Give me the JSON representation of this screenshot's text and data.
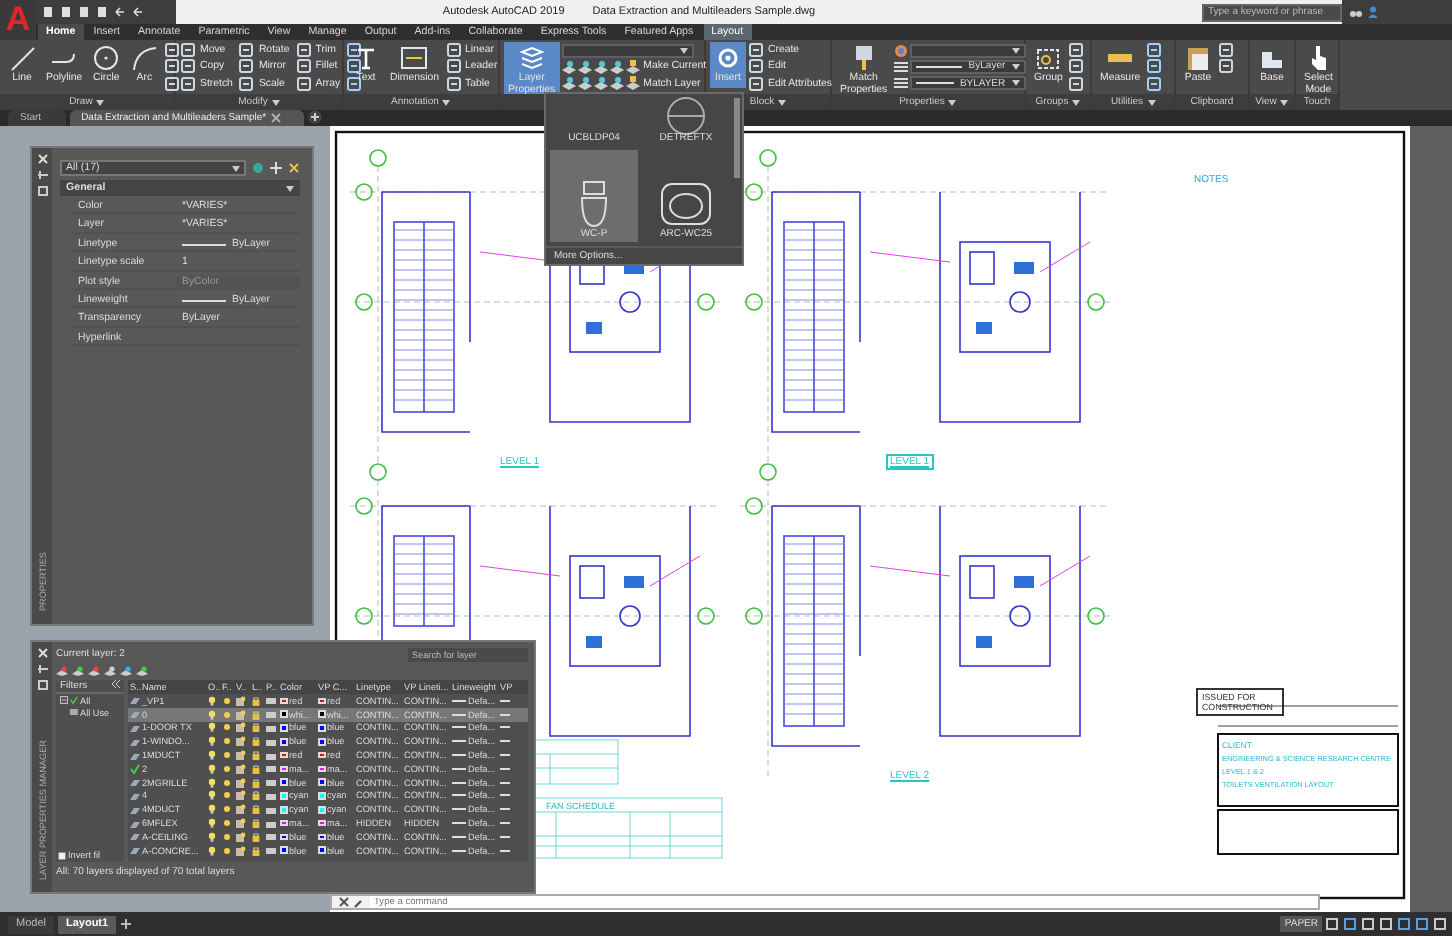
{
  "title_bar": {
    "app_letter": "A",
    "title": "Autodesk AutoCAD 2019",
    "document": "Data Extraction and Multileaders Sample.dwg",
    "search": {
      "placeholder": "Type a keyword or phrase"
    }
  },
  "ribbon_tabs": [
    {
      "label": "Home",
      "selected": true,
      "contextual": false
    },
    {
      "label": "Insert",
      "selected": false,
      "contextual": false
    },
    {
      "label": "Annotate",
      "selected": false,
      "contextual": false
    },
    {
      "label": "Parametric",
      "selected": false,
      "contextual": false
    },
    {
      "label": "View",
      "selected": false,
      "contextual": false
    },
    {
      "label": "Manage",
      "selected": false,
      "contextual": false
    },
    {
      "label": "Output",
      "selected": false,
      "contextual": false
    },
    {
      "label": "Add-ins",
      "selected": false,
      "contextual": false
    },
    {
      "label": "Collaborate",
      "selected": false,
      "contextual": false
    },
    {
      "label": "Express Tools",
      "selected": false,
      "contextual": false
    },
    {
      "label": "Featured Apps",
      "selected": false,
      "contextual": false
    },
    {
      "label": "Layout",
      "selected": false,
      "contextual": true
    }
  ],
  "ribbon_panels": [
    {
      "label": "Draw",
      "menu": true,
      "tools": [
        {
          "kind": "large",
          "label": "Line",
          "active": false
        },
        {
          "kind": "large",
          "label": "Polyline",
          "active": false
        },
        {
          "kind": "large",
          "label": "Circle",
          "active": false
        },
        {
          "kind": "large",
          "label": "Arc",
          "active": false
        },
        {
          "kind": "icon"
        },
        {
          "kind": "icon"
        },
        {
          "kind": "icon"
        }
      ]
    },
    {
      "label": "Modify",
      "menu": true,
      "tools": [
        {
          "kind": "small",
          "label": "Move"
        },
        {
          "kind": "small",
          "label": "Copy"
        },
        {
          "kind": "small",
          "label": "Stretch"
        },
        {
          "kind": "small",
          "label": "Rotate"
        },
        {
          "kind": "small",
          "label": "Mirror"
        },
        {
          "kind": "small",
          "label": "Scale"
        },
        {
          "kind": "small",
          "label": "Trim"
        },
        {
          "kind": "small",
          "label": "Fillet"
        },
        {
          "kind": "small",
          "label": "Array"
        },
        {
          "kind": "icon"
        },
        {
          "kind": "icon"
        },
        {
          "kind": "icon"
        }
      ]
    },
    {
      "label": "Annotation",
      "menu": true,
      "tools": [
        {
          "kind": "large",
          "label": "Text",
          "active": false
        },
        {
          "kind": "large",
          "label": "Dimension",
          "active": false
        },
        {
          "kind": "small",
          "label": "Linear"
        },
        {
          "kind": "small",
          "label": "Leader"
        },
        {
          "kind": "small",
          "label": "Table"
        }
      ]
    },
    {
      "tools": [
        {
          "kind": "large",
          "label": "Layer Properties",
          "active": true
        },
        {
          "kind": "dropdown"
        },
        {
          "kind": "layer-row",
          "label": "Make Current"
        },
        {
          "kind": "layer-row",
          "label": "Match Layer"
        }
      ]
    },
    {
      "label": "Block",
      "menu": true,
      "tools": [
        {
          "kind": "large",
          "label": "Insert",
          "active": true
        },
        {
          "kind": "small",
          "label": "Create"
        },
        {
          "kind": "small",
          "label": "Edit"
        },
        {
          "kind": "small",
          "label": "Edit Attributes"
        }
      ]
    },
    {
      "label": "Properties",
      "menu": true,
      "tools": [
        {
          "kind": "large",
          "label": "Match Properties",
          "active": false
        },
        {
          "kind": "color-dropdown"
        },
        {
          "kind": "line-dropdown",
          "label": "ByLayer"
        },
        {
          "kind": "line-dropdown",
          "label": "BYLAYER"
        }
      ]
    },
    {
      "label": "Groups",
      "menu": true,
      "tools": [
        {
          "kind": "large",
          "label": "Group",
          "active": false
        },
        {
          "kind": "icon"
        },
        {
          "kind": "icon"
        },
        {
          "kind": "icon"
        }
      ]
    },
    {
      "label": "Utilities",
      "menu": true,
      "tools": [
        {
          "kind": "large",
          "label": "Measure",
          "active": false
        },
        {
          "kind": "icon"
        },
        {
          "kind": "icon"
        },
        {
          "kind": "icon"
        }
      ]
    },
    {
      "label": "Clipboard",
      "menu": false,
      "tools": [
        {
          "kind": "large",
          "label": "Paste",
          "active": false
        },
        {
          "kind": "icon"
        },
        {
          "kind": "icon"
        }
      ]
    },
    {
      "label": "View",
      "menu": true,
      "tools": [
        {
          "kind": "large",
          "label": "Base",
          "active": false
        }
      ]
    },
    {
      "label": "Touch",
      "menu": false,
      "tools": [
        {
          "kind": "large",
          "label": "Select Mode",
          "active": false
        }
      ]
    }
  ],
  "block_gallery": {
    "items": [
      {
        "label": "UCBLDP04",
        "selected": false
      },
      {
        "label": "DETREFTX",
        "selected": false
      },
      {
        "label": "WC-P",
        "selected": true
      },
      {
        "label": "ARC-WC25",
        "selected": false
      }
    ],
    "more": "More Options..."
  },
  "file_tabs": [
    {
      "label": "Start",
      "selected": false
    },
    {
      "label": "Data Extraction and Multileaders Sample*",
      "selected": true
    }
  ],
  "properties_palette": {
    "title": "PROPERTIES",
    "selection": "All (17)",
    "section": "General",
    "rows": [
      {
        "label": "Color",
        "value": "*VARIES*",
        "kind": "text",
        "disabled": false
      },
      {
        "label": "Layer",
        "value": "*VARIES*",
        "kind": "text",
        "disabled": false
      },
      {
        "label": "Linetype",
        "value": "ByLayer",
        "kind": "line",
        "disabled": false
      },
      {
        "label": "Linetype scale",
        "value": "1",
        "kind": "text",
        "disabled": false
      },
      {
        "label": "Plot style",
        "value": "ByColor",
        "kind": "text",
        "disabled": true
      },
      {
        "label": "Lineweight",
        "value": "ByLayer",
        "kind": "line",
        "disabled": false
      },
      {
        "label": "Transparency",
        "value": "ByLayer",
        "kind": "text",
        "disabled": false
      },
      {
        "label": "Hyperlink"
      }
    ]
  },
  "layers": {
    "title": "LAYER PROPERTIES MANAGER",
    "current": "Current layer: 2",
    "search": {
      "placeholder": "Search for layer"
    },
    "filters_heading": "Filters",
    "filter_tree": [
      {
        "label": "All",
        "children": [
          {
            "label": "All Use"
          }
        ]
      }
    ],
    "invert": "Invert fil",
    "columns": [
      "S..",
      "Name",
      "O..",
      "F..",
      "V..",
      "L..",
      "P..",
      "Color",
      "VP C...",
      "Linetype",
      "VP Lineti...",
      "Lineweight",
      "VP"
    ],
    "rows": [
      {
        "name": "_VP1",
        "current": false,
        "selected": false,
        "color": "#ff0000",
        "color_name": "red",
        "vp_color": {
          "color": "#ff0000",
          "label": "red"
        },
        "linetype": "CONTIN...",
        "vp_linetype": "CONTIN...",
        "lineweight": "Defa..."
      },
      {
        "name": "0",
        "current": false,
        "selected": true,
        "color": "#000000",
        "color_name": "whi...",
        "vp_color": {
          "color": "#000000",
          "label": "whi..."
        },
        "linetype": "CONTIN...",
        "vp_linetype": "CONTIN...",
        "lineweight": "Defa..."
      },
      {
        "name": "1-DOOR TX",
        "current": false,
        "selected": false,
        "color": "#0000ff",
        "color_name": "blue",
        "vp_color": {
          "color": "#0000ff",
          "label": "blue"
        },
        "linetype": "CONTIN...",
        "vp_linetype": "CONTIN...",
        "lineweight": "Defa..."
      },
      {
        "name": "1-WINDO...",
        "current": false,
        "selected": false,
        "color": "#0000ff",
        "color_name": "blue",
        "vp_color": {
          "color": "#0000ff",
          "label": "blue"
        },
        "linetype": "CONTIN...",
        "vp_linetype": "CONTIN...",
        "lineweight": "Defa..."
      },
      {
        "name": "1MDUCT",
        "current": false,
        "selected": false,
        "color": "#ff0000",
        "color_name": "red",
        "vp_color": {
          "color": "#ff0000",
          "label": "red"
        },
        "linetype": "CONTIN...",
        "vp_linetype": "CONTIN...",
        "lineweight": "Defa..."
      },
      {
        "name": "2",
        "current": true,
        "selected": false,
        "color": "#ff00ff",
        "color_name": "ma...",
        "vp_color": {
          "color": "#ff00ff",
          "label": "ma..."
        },
        "linetype": "CONTIN...",
        "vp_linetype": "CONTIN...",
        "lineweight": "Defa..."
      },
      {
        "name": "2MGRILLE",
        "current": false,
        "selected": false,
        "color": "#0000ff",
        "color_name": "blue",
        "vp_color": {
          "color": "#0000ff",
          "label": "blue"
        },
        "linetype": "CONTIN...",
        "vp_linetype": "CONTIN...",
        "lineweight": "Defa..."
      },
      {
        "name": "4",
        "current": false,
        "selected": false,
        "color": "#00ffff",
        "color_name": "cyan",
        "vp_color": {
          "color": "#00ffff",
          "label": "cyan"
        },
        "linetype": "CONTIN...",
        "vp_linetype": "CONTIN...",
        "lineweight": "Defa..."
      },
      {
        "name": "4MDUCT",
        "current": false,
        "selected": false,
        "color": "#00ffff",
        "color_name": "cyan",
        "vp_color": {
          "color": "#00ffff",
          "label": "cyan"
        },
        "linetype": "CONTIN...",
        "vp_linetype": "CONTIN...",
        "lineweight": "Defa..."
      },
      {
        "name": "6MFLEX",
        "current": false,
        "selected": false,
        "color": "#ff00ff",
        "color_name": "ma...",
        "vp_color": {
          "color": "#ff00ff",
          "label": "ma..."
        },
        "linetype": "HIDDEN",
        "vp_linetype": "HIDDEN",
        "lineweight": "Defa..."
      },
      {
        "name": "A-CEILING",
        "current": false,
        "selected": false,
        "color": "#0000ff",
        "color_name": "blue",
        "vp_color": {
          "color": "#0000ff",
          "label": "blue"
        },
        "linetype": "CONTIN...",
        "vp_linetype": "CONTIN...",
        "lineweight": "Defa..."
      },
      {
        "name": "A-CONCRE...",
        "current": false,
        "selected": false,
        "color": "#0000ff",
        "color_name": "blue",
        "vp_color": {
          "color": "#0000ff",
          "label": "blue"
        },
        "linetype": "CONTIN...",
        "vp_linetype": "CONTIN...",
        "lineweight": "Defa..."
      }
    ],
    "status": "All: 70 layers displayed of 70 total layers"
  },
  "sheet": {
    "level_labels": [
      {
        "label": "LEVEL 1",
        "selected": false
      },
      {
        "label": "LEVEL 1",
        "selected": true
      },
      {
        "label": "LEVEL 2",
        "selected": false
      }
    ],
    "notes_heading": "NOTES",
    "stamp": "ISSUED FOR CONSTRUCTION",
    "schedule_title": "FAN SCHEDULE",
    "title_block": [
      "CLIENT",
      "ENGINEERING & SCIENCE RESEARCH CENTRE",
      "LEVEL 1 & 2",
      "TOILETS VENTILATION LAYOUT"
    ]
  },
  "command_line": {
    "placeholder": "Type a command"
  },
  "layout_tabs": [
    {
      "label": "Model",
      "selected": false
    },
    {
      "label": "Layout1",
      "selected": true
    }
  ],
  "status_bar": {
    "space": "PAPER"
  }
}
